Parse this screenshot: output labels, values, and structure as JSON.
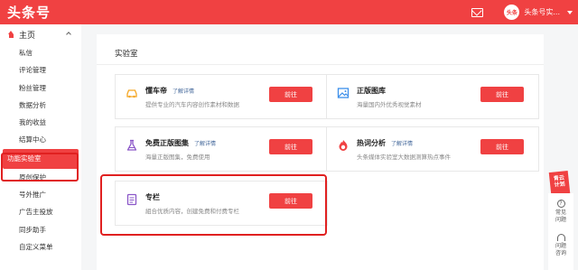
{
  "header": {
    "logo": "头条号",
    "avatar_text": "头条",
    "user_name": "头条号实..."
  },
  "sidebar": {
    "home_label": "主页",
    "items": [
      {
        "label": "私信"
      },
      {
        "label": "评论管理"
      },
      {
        "label": "粉丝管理"
      },
      {
        "label": "数据分析"
      },
      {
        "label": "我的收益"
      },
      {
        "label": "结算中心"
      },
      {
        "label": "功能实验室",
        "active": true
      },
      {
        "label": "原创保护"
      },
      {
        "label": "号外推广"
      },
      {
        "label": "广告主投放"
      },
      {
        "label": "同步助手"
      },
      {
        "label": "自定义菜单"
      }
    ]
  },
  "main": {
    "title": "实验室",
    "cards": [
      {
        "name": "懂车帝",
        "link": "了解详情",
        "desc": "提供专业的汽车内容创作素材和数据",
        "button": "前往",
        "icon": "car-icon",
        "icon_color": "#f5a623"
      },
      {
        "name": "正版图库",
        "link": "",
        "desc": "海量国内外优秀视觉素材",
        "button": "前往",
        "icon": "image-icon",
        "icon_color": "#3b8eea"
      },
      {
        "name": "免费正版图集",
        "link": "了解详情",
        "desc": "海量正版图集，免费使用",
        "button": "前往",
        "icon": "flask-icon",
        "icon_color": "#8a56c8"
      },
      {
        "name": "热词分析",
        "link": "了解详情",
        "desc": "头条媒体实验室大数据测算热点事件",
        "button": "前往",
        "icon": "hot-icon",
        "icon_color": "#f04142"
      },
      {
        "name": "专栏",
        "link": "",
        "desc": "組合优质内容，创建免费和付费专栏",
        "button": "前往",
        "icon": "column-icon",
        "icon_color": "#8a56c8"
      }
    ]
  },
  "float": {
    "badge_line1": "青云",
    "badge_line2": "计划",
    "help_label_1": "常见",
    "help_label_2": "问题",
    "consult_label_1": "问题",
    "consult_label_2": "咨询",
    "q_glyph": "?"
  },
  "colors": {
    "accent": "#f04142",
    "highlight": "#e02020"
  }
}
